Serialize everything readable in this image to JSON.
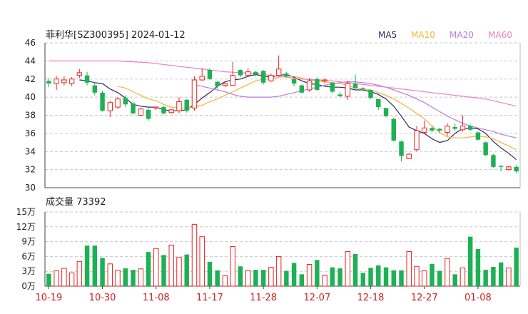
{
  "header": {
    "title": "菲利华[SZ300395] 2024-01-12",
    "legend": [
      {
        "label": "MA5",
        "color": "#2b2b60"
      },
      {
        "label": "MA10",
        "color": "#f4b340"
      },
      {
        "label": "MA20",
        "color": "#b67ee0"
      },
      {
        "label": "MA60",
        "color": "#f07fc3"
      }
    ]
  },
  "volume_title": "成交量 73392",
  "colors": {
    "up": "#ee2222",
    "down": "#1db153",
    "grid": "#c8c8c8",
    "axis_text": "#222222",
    "date_text": "#cc2222"
  },
  "chart_data": [
    {
      "type": "candlestick",
      "title": "菲利华[SZ300395] 2024-01-12",
      "ylim": [
        30,
        46
      ],
      "y_ticks": [
        "30",
        "32",
        "34",
        "36",
        "38",
        "40",
        "42",
        "44",
        "46"
      ],
      "x_ticks": [
        {
          "label": "10-19",
          "index": 0
        },
        {
          "label": "10-30",
          "index": 7
        },
        {
          "label": "11-08",
          "index": 14
        },
        {
          "label": "11-17",
          "index": 21
        },
        {
          "label": "11-28",
          "index": 28
        },
        {
          "label": "12-07",
          "index": 35
        },
        {
          "label": "12-18",
          "index": 42
        },
        {
          "label": "12-27",
          "index": 49
        },
        {
          "label": "01-08",
          "index": 56
        }
      ],
      "candles": [
        [
          41.8,
          41.5,
          42.1,
          41.1
        ],
        [
          41.5,
          42.0,
          42.3,
          40.8
        ],
        [
          41.6,
          41.9,
          42.3,
          41.3
        ],
        [
          41.5,
          42.0,
          42.2,
          41.2
        ],
        [
          42.4,
          42.7,
          43.1,
          42.1
        ],
        [
          42.4,
          41.6,
          42.8,
          41.3
        ],
        [
          41.3,
          40.5,
          41.6,
          40.2
        ],
        [
          40.5,
          38.5,
          40.7,
          38.4
        ],
        [
          38.5,
          39.4,
          39.6,
          37.8
        ],
        [
          38.9,
          39.8,
          40.0,
          38.7
        ],
        [
          39.9,
          39.2,
          40.2,
          38.9
        ],
        [
          39.3,
          38.2,
          39.5,
          38.1
        ],
        [
          38.0,
          38.7,
          38.8,
          37.9
        ],
        [
          38.6,
          37.6,
          38.8,
          37.4
        ],
        [
          38.8,
          38.9,
          39.0,
          38.6
        ],
        [
          38.9,
          38.2,
          39.0,
          38.1
        ],
        [
          38.3,
          38.6,
          38.7,
          38.2
        ],
        [
          38.5,
          39.5,
          40.0,
          38.2
        ],
        [
          39.7,
          38.5,
          39.8,
          38.3
        ],
        [
          38.8,
          41.9,
          42.3,
          38.5
        ],
        [
          41.9,
          42.3,
          43.2,
          41.8
        ],
        [
          43.0,
          42.0,
          43.2,
          41.9
        ],
        [
          41.7,
          41.2,
          41.8,
          40.9
        ],
        [
          41.3,
          41.5,
          41.7,
          41.1
        ],
        [
          41.3,
          42.4,
          43.9,
          41.3
        ],
        [
          43.0,
          42.4,
          43.1,
          42.2
        ],
        [
          42.4,
          42.8,
          43.2,
          42.3
        ],
        [
          42.8,
          42.5,
          42.9,
          42.3
        ],
        [
          42.9,
          41.6,
          43.0,
          41.4
        ],
        [
          41.8,
          42.4,
          42.6,
          41.7
        ],
        [
          42.4,
          43.1,
          44.6,
          42.3
        ],
        [
          42.6,
          42.3,
          42.8,
          42.2
        ],
        [
          42.0,
          41.5,
          42.1,
          41.2
        ],
        [
          41.3,
          40.5,
          41.4,
          40.4
        ],
        [
          40.8,
          41.8,
          42.1,
          40.6
        ],
        [
          42.0,
          40.8,
          42.2,
          40.7
        ],
        [
          41.8,
          41.9,
          42.1,
          41.5
        ],
        [
          41.6,
          40.6,
          41.7,
          40.4
        ],
        [
          40.3,
          40.1,
          40.6,
          40.0
        ],
        [
          40.1,
          41.5,
          41.8,
          39.7
        ],
        [
          41.5,
          41.0,
          42.5,
          40.9
        ],
        [
          41.0,
          40.9,
          41.1,
          40.8
        ],
        [
          40.8,
          39.9,
          40.8,
          39.8
        ],
        [
          39.8,
          38.9,
          39.8,
          38.6
        ],
        [
          38.8,
          37.9,
          38.8,
          37.8
        ],
        [
          37.6,
          35.2,
          37.7,
          35.1
        ],
        [
          35.1,
          33.5,
          35.2,
          32.9
        ],
        [
          33.2,
          33.7,
          33.8,
          33.2
        ],
        [
          34.2,
          36.3,
          36.8,
          34.0
        ],
        [
          36.1,
          36.6,
          37.4,
          35.9
        ],
        [
          36.6,
          36.3,
          36.9,
          36.1
        ],
        [
          36.5,
          36.3,
          36.6,
          36.0
        ],
        [
          36.1,
          36.8,
          37.1,
          35.7
        ],
        [
          36.7,
          36.5,
          37.1,
          36.3
        ],
        [
          36.4,
          36.8,
          38.0,
          36.2
        ],
        [
          36.8,
          36.4,
          37.0,
          36.3
        ],
        [
          36.1,
          35.3,
          36.2,
          35.2
        ],
        [
          35.0,
          33.6,
          35.1,
          33.5
        ],
        [
          33.6,
          32.3,
          33.7,
          32.2
        ],
        [
          32.4,
          32.3,
          32.5,
          31.8
        ],
        [
          32.0,
          32.3,
          32.4,
          31.9
        ],
        [
          32.3,
          31.8,
          32.5,
          31.6
        ]
      ],
      "ma": {
        "MA5": [
          null,
          null,
          null,
          null,
          41.9,
          41.8,
          41.6,
          41.5,
          40.9,
          40.5,
          39.9,
          39.2,
          39.0,
          38.9,
          38.9,
          38.6,
          38.5,
          38.5,
          38.6,
          39.2,
          39.9,
          40.5,
          41.2,
          41.7,
          41.9,
          42.0,
          42.3,
          42.5,
          42.3,
          42.2,
          42.4,
          42.5,
          42.2,
          41.8,
          41.5,
          41.4,
          41.2,
          41.1,
          41.1,
          41.0,
          40.8,
          40.8,
          40.6,
          40.3,
          39.8,
          39.0,
          37.9,
          36.7,
          36.3,
          36.0,
          35.4,
          35.0,
          35.2,
          36.0,
          36.5,
          36.6,
          36.5,
          36.0,
          35.1,
          34.4,
          33.8,
          33.1
        ],
        "MA10": [
          null,
          null,
          null,
          null,
          null,
          null,
          null,
          null,
          null,
          41.2,
          41.0,
          40.6,
          40.2,
          39.8,
          39.6,
          39.2,
          38.9,
          38.8,
          38.8,
          38.9,
          39.1,
          39.5,
          39.8,
          40.2,
          40.6,
          41.0,
          41.4,
          41.8,
          42.0,
          42.0,
          42.2,
          42.3,
          42.3,
          42.1,
          41.9,
          41.8,
          41.7,
          41.6,
          41.5,
          41.3,
          41.0,
          40.9,
          40.8,
          40.5,
          40.2,
          39.8,
          39.3,
          38.8,
          38.2,
          37.6,
          36.8,
          36.1,
          35.6,
          35.5,
          35.5,
          35.6,
          35.7,
          35.6,
          35.4,
          35.0,
          34.6,
          34.2
        ],
        "MA20": [
          null,
          null,
          null,
          null,
          null,
          null,
          null,
          null,
          null,
          null,
          null,
          null,
          null,
          null,
          null,
          null,
          null,
          null,
          null,
          41.4,
          41.2,
          41.0,
          40.8,
          40.6,
          40.3,
          40.1,
          40.0,
          40.0,
          40.0,
          40.0,
          40.1,
          40.3,
          40.5,
          40.7,
          40.9,
          41.1,
          41.3,
          41.5,
          41.6,
          41.7,
          41.7,
          41.6,
          41.5,
          41.3,
          41.1,
          40.8,
          40.5,
          40.2,
          39.8,
          39.4,
          38.9,
          38.4,
          37.9,
          37.5,
          37.1,
          36.8,
          36.6,
          36.4,
          36.2,
          35.9,
          35.7,
          35.5
        ],
        "MA60": [
          44.0,
          44.0,
          44.0,
          44.0,
          44.0,
          44.0,
          44.0,
          44.0,
          44.0,
          44.0,
          43.95,
          43.9,
          43.85,
          43.8,
          43.7,
          43.6,
          43.5,
          43.4,
          43.3,
          43.2,
          43.1,
          43.0,
          42.9,
          42.8,
          42.75,
          42.7,
          42.65,
          42.6,
          42.5,
          42.4,
          42.3,
          42.2,
          42.1,
          42.0,
          41.95,
          41.9,
          41.85,
          41.8,
          41.7,
          41.6,
          41.5,
          41.4,
          41.3,
          41.2,
          41.1,
          41.0,
          40.9,
          40.8,
          40.7,
          40.6,
          40.5,
          40.4,
          40.3,
          40.2,
          40.1,
          40.0,
          39.9,
          39.8,
          39.6,
          39.4,
          39.2,
          39.0
        ]
      }
    },
    {
      "type": "bar",
      "title": "成交量 73392",
      "ylim": [
        0,
        150000
      ],
      "y_ticks": [
        "15万",
        "12万",
        "9万",
        "6万",
        "3万",
        "0万"
      ],
      "volume": [
        25000,
        31000,
        36000,
        27000,
        50000,
        82000,
        82000,
        57000,
        45000,
        32000,
        36000,
        33000,
        35000,
        69000,
        76000,
        63000,
        83000,
        58000,
        64000,
        125000,
        100000,
        49000,
        32000,
        21000,
        80000,
        40000,
        31000,
        33000,
        33000,
        38000,
        60000,
        31000,
        47000,
        24000,
        44000,
        53000,
        22000,
        38000,
        36000,
        70000,
        65000,
        27000,
        37000,
        42000,
        38000,
        32000,
        32000,
        70000,
        40000,
        31000,
        45000,
        31000,
        56000,
        24000,
        37000,
        100000,
        75000,
        33000,
        39000,
        48000,
        37000,
        78000
      ]
    }
  ]
}
